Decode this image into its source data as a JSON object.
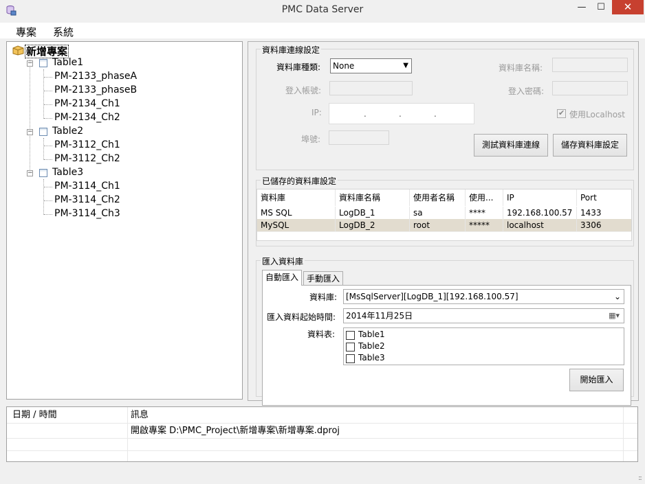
{
  "window": {
    "title": "PMC Data Server",
    "minimize_glyph": "—",
    "maximize_glyph": "☐",
    "close_glyph": "✕"
  },
  "menu": {
    "items": [
      "專案",
      "系統"
    ]
  },
  "tree": {
    "root": "新增專案",
    "tables": [
      {
        "name": "Table1",
        "children": [
          "PM-2133_phaseA",
          "PM-2133_phaseB",
          "PM-2134_Ch1",
          "PM-2134_Ch2"
        ]
      },
      {
        "name": "Table2",
        "children": [
          "PM-3112_Ch1",
          "PM-3112_Ch2"
        ]
      },
      {
        "name": "Table3",
        "children": [
          "PM-3114_Ch1",
          "PM-3114_Ch2",
          "PM-3114_Ch3"
        ]
      }
    ]
  },
  "db_connection": {
    "group_title": "資料庫連線設定",
    "db_type_label": "資料庫種類:",
    "db_type_value": "None",
    "db_name_label": "資料庫名稱:",
    "login_account_label": "登入帳號:",
    "login_password_label": "登入密碼:",
    "ip_label": "IP:",
    "ip_dots": ".",
    "use_localhost_label": "使用Localhost",
    "port_label": "埠號:",
    "test_button": "測試資料庫連線",
    "save_button": "儲存資料庫設定"
  },
  "saved_db": {
    "group_title": "已儲存的資料庫設定",
    "columns": [
      "資料庫",
      "資料庫名稱",
      "使用者名稱",
      "使用...",
      "IP",
      "Port"
    ],
    "rows": [
      [
        "MS SQL",
        "LogDB_1",
        "sa",
        "****",
        "192.168.100.57",
        "1433"
      ],
      [
        "MySQL",
        "LogDB_2",
        "root",
        "*****",
        "localhost",
        "3306"
      ]
    ]
  },
  "import": {
    "group_title": "匯入資料庫",
    "tabs": [
      "自動匯入",
      "手動匯入"
    ],
    "database_label": "資料庫:",
    "database_value": "[MsSqlServer][LogDB_1][192.168.100.57]",
    "start_time_label": "匯入資料起始時間:",
    "start_time_value": "2014年11月25日",
    "tables_label": "資料表:",
    "tables": [
      "Table1",
      "Table2",
      "Table3"
    ],
    "start_button": "開始匯入"
  },
  "log": {
    "col_datetime": "日期 / 時間",
    "col_message": "訊息",
    "entries": [
      {
        "time": "",
        "message": "開啟專案  D:\\PMC_Project\\新增專案\\新增專案.dproj"
      }
    ]
  },
  "status": {
    "grip": ":::"
  }
}
